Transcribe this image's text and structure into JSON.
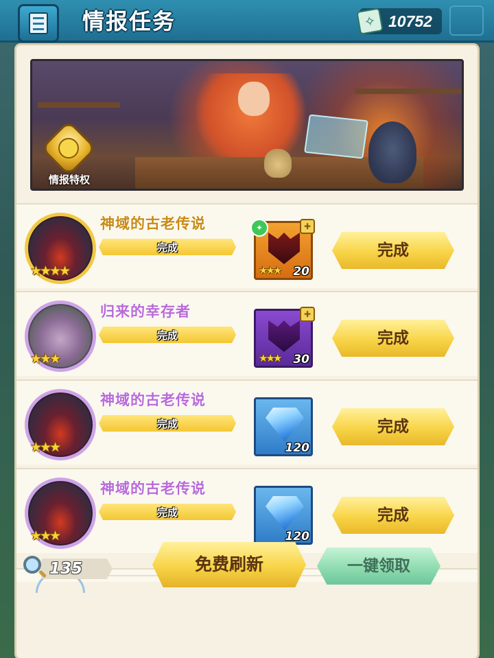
{
  "header": {
    "title": "情报任务",
    "currency_value": "10752",
    "currency_icon": "intel-ticket-icon",
    "menu_icon": "scroll-icon"
  },
  "banner": {
    "privilege_label": "情报特权",
    "privilege_icon": "compass-medal-icon"
  },
  "quests": [
    {
      "name": "神域的古老传说",
      "name_color": "#c98a12",
      "frame": "gold",
      "avatar": "demon-avatar",
      "stars": "★★★★",
      "progress_label": "完成",
      "progress": 1.0,
      "reward": {
        "type": "orange",
        "icon": "demon-emblem-icon",
        "stars": "★★★",
        "qty": "20",
        "tag": "green-badge"
      },
      "action_label": "完成"
    },
    {
      "name": "归来的幸存者",
      "name_color": "#b86ad8",
      "frame": "purple",
      "avatar": "goblin-avatar",
      "stars": "★★★",
      "progress_label": "完成",
      "progress": 1.0,
      "reward": {
        "type": "purple",
        "icon": "demon-emblem-icon",
        "stars": "★★★",
        "qty": "30"
      },
      "action_label": "完成"
    },
    {
      "name": "神域的古老传说",
      "name_color": "#b86ad8",
      "frame": "purple",
      "avatar": "demon-avatar",
      "stars": "★★★",
      "progress_label": "完成",
      "progress": 1.0,
      "reward": {
        "type": "blue",
        "icon": "diamond-icon",
        "qty": "120"
      },
      "action_label": "完成"
    },
    {
      "name": "神域的古老传说",
      "name_color": "#b86ad8",
      "frame": "purple",
      "avatar": "demon-avatar",
      "stars": "★★★",
      "progress_label": "完成",
      "progress": 1.0,
      "reward": {
        "type": "blue",
        "icon": "diamond-icon",
        "qty": "120"
      },
      "action_label": "完成"
    }
  ],
  "footer": {
    "magnifier_count": "135",
    "refresh_label": "免费刷新",
    "claim_all_label": "一键领取"
  }
}
